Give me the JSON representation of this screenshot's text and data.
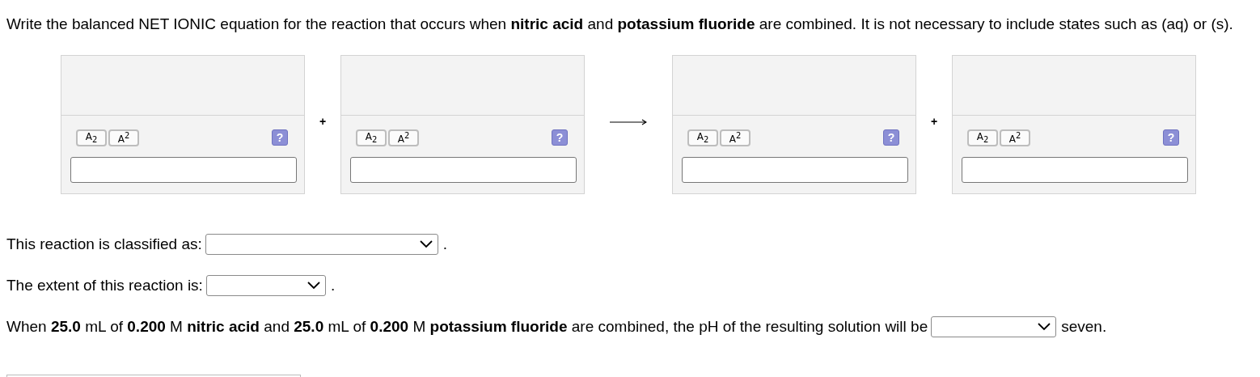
{
  "prompt": "Write the balanced NET IONIC equation for the reaction that occurs when **nitric acid** and **potassium fluoride** are combined. It is not necessary to include states such as (aq) or (s).",
  "equation": [
    {
      "kind": "box",
      "tools": [
        "A$_{2}$",
        "A$^{2}$"
      ],
      "help": "?"
    },
    {
      "kind": "plus",
      "symbol": "+"
    },
    {
      "kind": "box",
      "tools": [
        "A$_{2}$",
        "A$^{2}$"
      ],
      "help": "?"
    },
    {
      "kind": "arrow"
    },
    {
      "kind": "box",
      "tools": [
        "A$_{2}$",
        "A$^{2}$"
      ],
      "help": "?"
    },
    {
      "kind": "plus",
      "symbol": "+"
    },
    {
      "kind": "box",
      "tools": [
        "A$_{2}$",
        "A$^{2}$"
      ],
      "help": "?"
    }
  ],
  "questions": [
    {
      "before": "This reaction is classified as:",
      "after": "."
    },
    {
      "before": "The extent of this reaction is:",
      "after": "."
    },
    {
      "before": "When **25.0** mL of **0.200** M **nitric acid** and **25.0** mL of **0.200** M **potassium fluoride** are combined, the pH of the resulting solution will be",
      "after": "seven."
    }
  ]
}
